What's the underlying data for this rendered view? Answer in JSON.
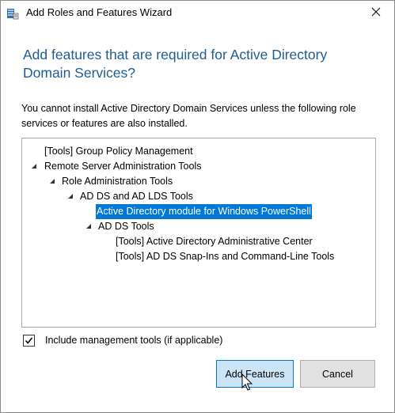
{
  "window": {
    "title": "Add Roles and Features Wizard",
    "close_symbol": "✕"
  },
  "heading": "Add features that are required for Active Directory Domain Services?",
  "description": "You cannot install Active Directory Domain Services unless the following role services or features are also installed.",
  "tree": {
    "items": [
      {
        "label": "[Tools] Group Policy Management",
        "expanded": false,
        "selected": false
      },
      {
        "label": "Remote Server Administration Tools",
        "expanded": true,
        "selected": false
      },
      {
        "label": "Role Administration Tools",
        "expanded": true,
        "selected": false
      },
      {
        "label": "AD DS and AD LDS Tools",
        "expanded": true,
        "selected": false
      },
      {
        "label": "Active Directory module for Windows PowerShell",
        "expanded": false,
        "selected": true
      },
      {
        "label": "AD DS Tools",
        "expanded": true,
        "selected": false
      },
      {
        "label": "[Tools] Active Directory Administrative Center",
        "expanded": false,
        "selected": false
      },
      {
        "label": "[Tools] AD DS Snap-Ins and Command-Line Tools",
        "expanded": false,
        "selected": false
      }
    ]
  },
  "include_tools": {
    "label": "Include management tools (if applicable)",
    "checked": true
  },
  "buttons": {
    "add_label": "Add Features",
    "cancel_label": "Cancel"
  },
  "colors": {
    "heading": "#1e5c93",
    "selection": "#0078d7",
    "primary_button_bg": "#cce4f7",
    "primary_button_border": "#0078d7"
  },
  "icons": {
    "window": "server-manager-icon",
    "close": "close-icon",
    "expand": "expanded-triangle-icon",
    "check": "checkmark-icon",
    "cursor": "mouse-pointer-icon"
  }
}
